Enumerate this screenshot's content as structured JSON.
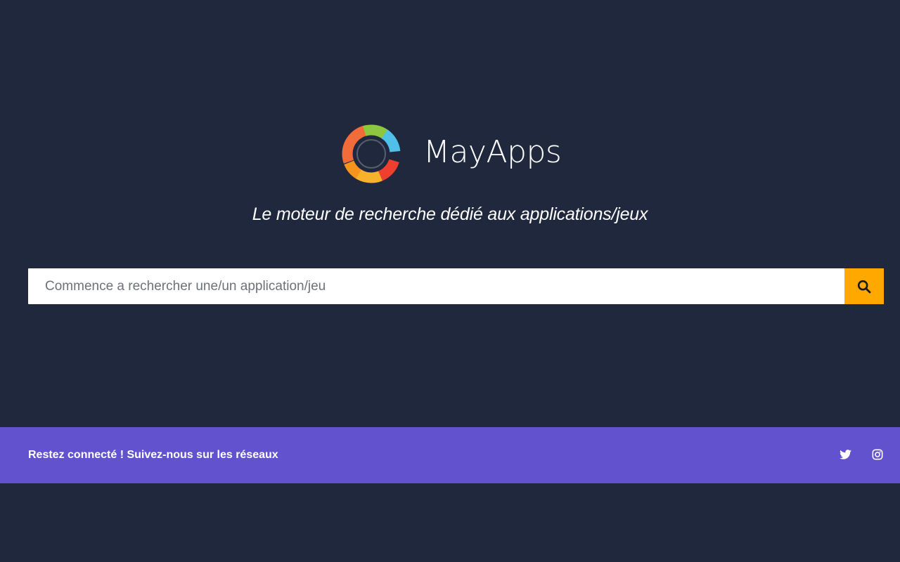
{
  "brand": {
    "name": "MayApps",
    "logo_icon": "mayapps-ring-logo"
  },
  "tagline": "Le moteur de recherche dédié aux applications/jeux",
  "search": {
    "placeholder": "Commence a rechercher une/un application/jeu",
    "value": "",
    "button_icon": "search-icon"
  },
  "footer": {
    "text": "Restez connecté ! Suivez-nous sur les réseaux",
    "social": [
      {
        "icon": "twitter-icon"
      },
      {
        "icon": "instagram-icon"
      }
    ]
  },
  "colors": {
    "background": "#1f283d",
    "footer_band": "#6352cd",
    "search_button": "#ffa800",
    "text": "#ffffff"
  }
}
